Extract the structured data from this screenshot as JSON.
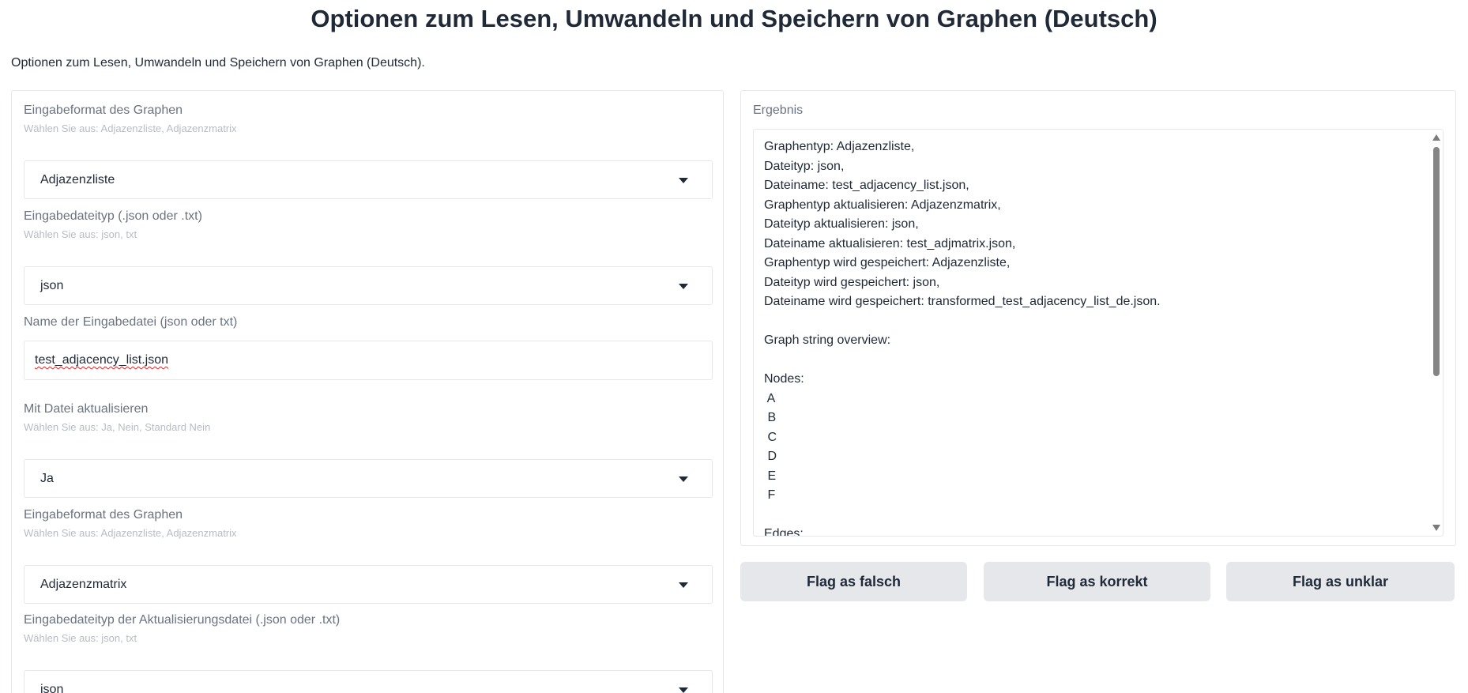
{
  "page": {
    "title": "Optionen zum Lesen, Umwandeln und Speichern von Graphen (Deutsch)",
    "description": "Optionen zum Lesen, Umwandeln und Speichern von Graphen (Deutsch)."
  },
  "form": {
    "graph_format": {
      "label": "Eingabeformat des Graphen",
      "info": "Wählen Sie aus: Adjazenzliste, Adjazenzmatrix",
      "value": "Adjazenzliste"
    },
    "file_type": {
      "label": "Eingabedateityp (.json oder .txt)",
      "info": "Wählen Sie aus: json, txt",
      "value": "json"
    },
    "file_name": {
      "label": "Name der Eingabedatei (json oder txt)",
      "value": "test_adjacency_list.json"
    },
    "update_with_file": {
      "label": "Mit Datei aktualisieren",
      "info": "Wählen Sie aus: Ja, Nein, Standard Nein",
      "value": "Ja"
    },
    "update_graph_format": {
      "label": "Eingabeformat des Graphen",
      "info": "Wählen Sie aus: Adjazenzliste, Adjazenzmatrix",
      "value": "Adjazenzmatrix"
    },
    "update_file_type": {
      "label": "Eingabedateityp der Aktualisierungsdatei (.json oder .txt)",
      "info": "Wählen Sie aus: json, txt",
      "value": "json"
    }
  },
  "result": {
    "label": "Ergebnis",
    "text": "Graphentyp: Adjazenzliste,\nDateityp: json,\nDateiname: test_adjacency_list.json,\nGraphentyp aktualisieren: Adjazenzmatrix,\nDateityp aktualisieren: json,\nDateiname aktualisieren: test_adjmatrix.json,\nGraphentyp wird gespeichert: Adjazenzliste,\nDateityp wird gespeichert: json,\nDateiname wird gespeichert: transformed_test_adjacency_list_de.json.\n\nGraph string overview:\n\nNodes:\n A\n B\n C\n D\n E\n F\n\nEdges:"
  },
  "flags": {
    "falsch": "Flag as falsch",
    "korrekt": "Flag as korrekt",
    "unklar": "Flag as unklar"
  }
}
